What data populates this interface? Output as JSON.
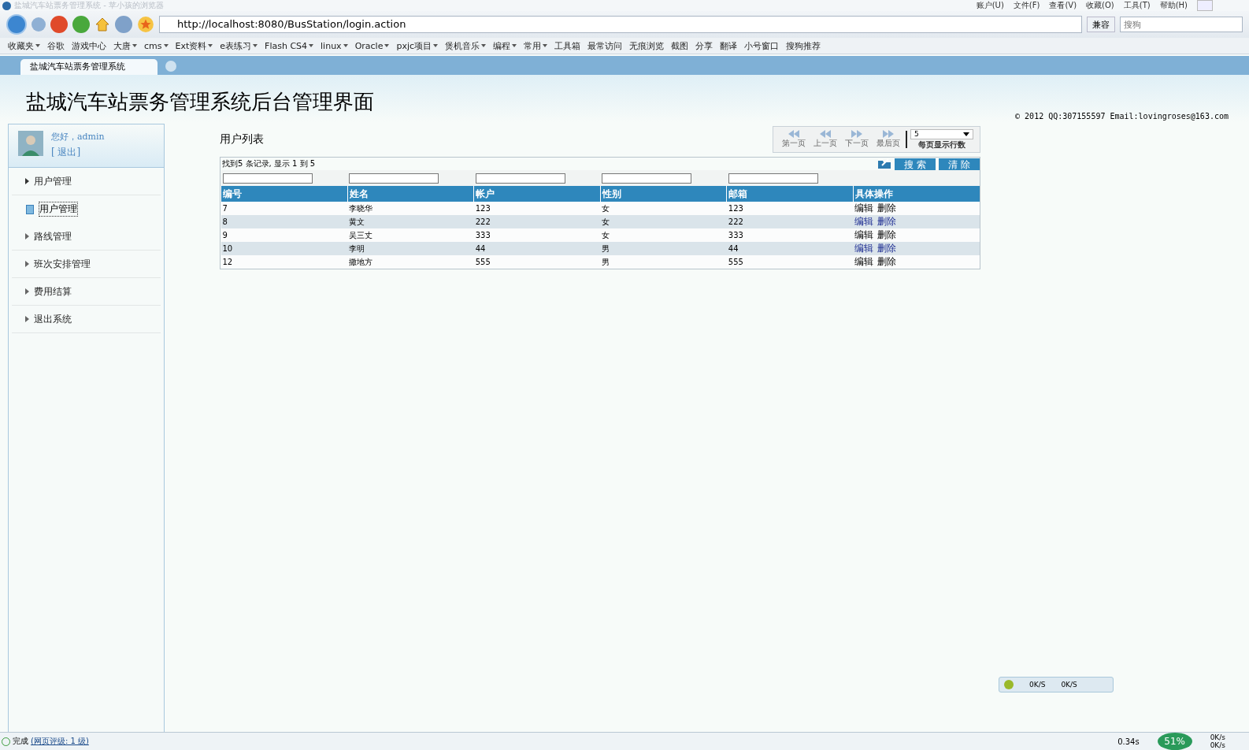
{
  "window": {
    "title": "盐城汽车站票务管理系统 - 苹小孩的浏览器",
    "menus": [
      "账户(U)",
      "文件(F)",
      "查看(V)",
      "收藏(O)",
      "工具(T)",
      "帮助(H)"
    ]
  },
  "address_bar": {
    "url": "http://localhost:8080/BusStation/login.action",
    "compat_button": "兼容",
    "search_placeholder": "搜狗"
  },
  "bookmarks": [
    {
      "label": "收藏夹",
      "dropdown": true
    },
    {
      "label": "谷歌",
      "dropdown": false
    },
    {
      "label": "游戏中心",
      "dropdown": false
    },
    {
      "label": "大唐",
      "dropdown": true
    },
    {
      "label": "cms",
      "dropdown": true
    },
    {
      "label": "Ext资料",
      "dropdown": true
    },
    {
      "label": "e表练习",
      "dropdown": true
    },
    {
      "label": "Flash CS4",
      "dropdown": true
    },
    {
      "label": "linux",
      "dropdown": true
    },
    {
      "label": "Oracle",
      "dropdown": true
    },
    {
      "label": "pxjc项目",
      "dropdown": true
    },
    {
      "label": "煲机音乐",
      "dropdown": true
    },
    {
      "label": "编程",
      "dropdown": true
    },
    {
      "label": "常用",
      "dropdown": true
    }
  ],
  "tools": [
    "工具箱",
    "最常访问",
    "无痕浏览",
    "截图",
    "分享",
    "翻译",
    "小号窗口",
    "搜狗推荐"
  ],
  "tabs": [
    {
      "label": "盐城汽车站票务管理系统",
      "selected": true
    }
  ],
  "page": {
    "title": "盐城汽车站票务管理系统后台管理界面",
    "copyright": "© 2012 QQ:307155597 Email:lovingroses@163.com"
  },
  "user": {
    "greeting": "您好，admin",
    "logout": "[ 退出]"
  },
  "sidebar": {
    "items": [
      {
        "label": "用户管理",
        "expanded": true,
        "children": [
          {
            "label": "用户管理",
            "selected": true
          }
        ]
      },
      {
        "label": "路线管理",
        "expanded": false
      },
      {
        "label": "班次安排管理",
        "expanded": false
      },
      {
        "label": "费用结算",
        "expanded": false
      },
      {
        "label": "退出系统",
        "expanded": false
      }
    ]
  },
  "list": {
    "title": "用户列表",
    "summary": "找到5 条记录, 显示  1 到  5",
    "search_button": "搜 索",
    "clear_button": "清 除",
    "pager": {
      "buttons": [
        "第一页",
        "上一页",
        "下一页",
        "最后页"
      ],
      "rows_per_page": "5",
      "rows_label": "每页显示行数"
    },
    "columns": [
      "编号",
      "姓名",
      "帐户",
      "性别",
      "邮箱",
      "具体操作"
    ],
    "rows": [
      {
        "cells": [
          "7",
          "李晓华",
          "123",
          "女",
          "123"
        ],
        "actions": [
          "编辑",
          "删除"
        ],
        "visited": false
      },
      {
        "cells": [
          "8",
          "黄文",
          "222",
          "女",
          "222"
        ],
        "actions": [
          "编辑",
          "删除"
        ],
        "visited": true
      },
      {
        "cells": [
          "9",
          "吴三丈",
          "333",
          "女",
          "333"
        ],
        "actions": [
          "编辑",
          "删除"
        ],
        "visited": false
      },
      {
        "cells": [
          "10",
          "李明",
          "44",
          "男",
          "44"
        ],
        "actions": [
          "编辑",
          "删除"
        ],
        "visited": true
      },
      {
        "cells": [
          "12",
          "撒地方",
          "555",
          "男",
          "555"
        ],
        "actions": [
          "编辑",
          "删除"
        ],
        "visited": false
      }
    ]
  },
  "net_widget": {
    "down": "0K/S",
    "up": "0K/S"
  },
  "status_bar": {
    "status": "完成",
    "rating": "(网页评级: 1 级)",
    "time": "0.34s",
    "percent": "51%",
    "up": "0K/s",
    "down": "0K/s"
  }
}
